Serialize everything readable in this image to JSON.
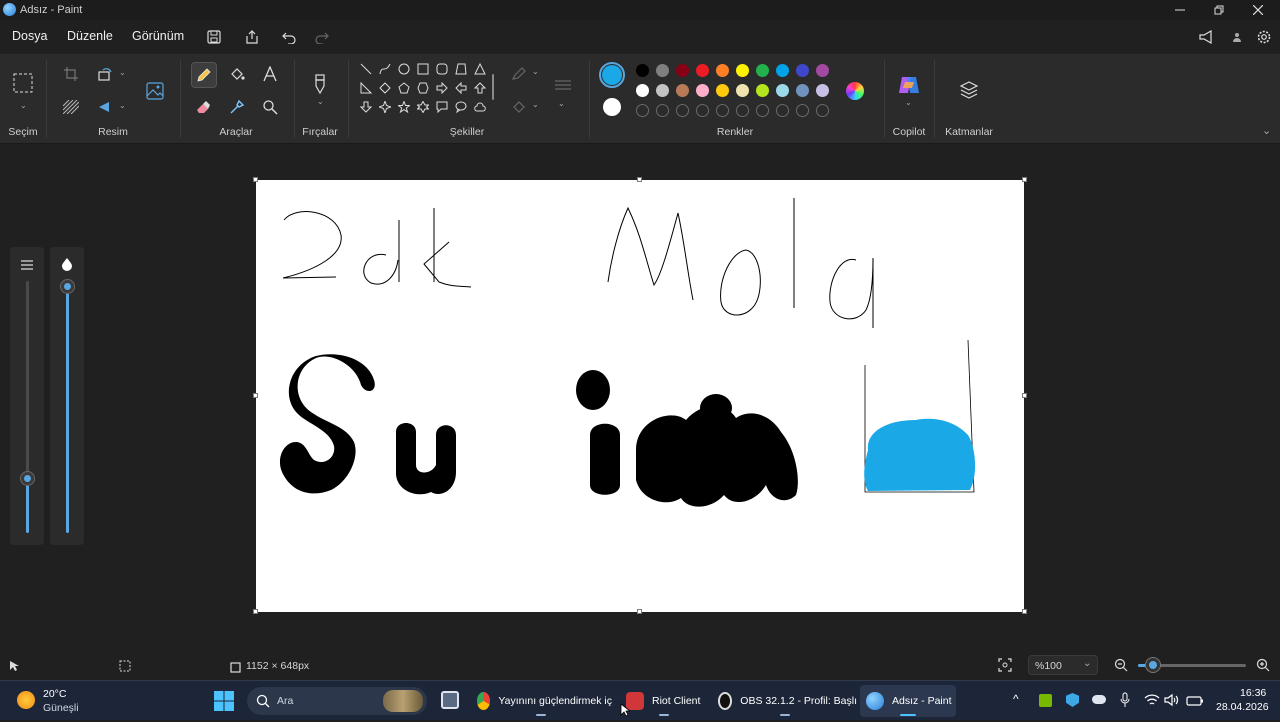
{
  "window": {
    "title": "Adsız - Paint"
  },
  "menu": {
    "file": "Dosya",
    "edit": "Düzenle",
    "view": "Görünüm"
  },
  "ribbon": {
    "groups": {
      "selection": "Seçim",
      "image": "Resim",
      "tools": "Araçlar",
      "brushes": "Fırçalar",
      "shapes": "Şekiller",
      "colors": "Renkler",
      "copilot": "Copilot",
      "layers": "Katmanlar"
    },
    "primary_color": "#1aa8e6",
    "secondary_color": "#ffffff",
    "palette_row1": [
      "#000000",
      "#7f7f7f",
      "#880015",
      "#ed1c24",
      "#ff7f27",
      "#fff200",
      "#22b14c",
      "#00a2e8",
      "#3f48cc",
      "#a349a4"
    ],
    "palette_row2": [
      "#ffffff",
      "#c3c3c3",
      "#b97a57",
      "#ffaec9",
      "#ffc90e",
      "#efe4b0",
      "#b5e61d",
      "#99d9ea",
      "#7092be",
      "#c8bfe7"
    ]
  },
  "status": {
    "canvas_size": "1152 × 648px",
    "zoom": "%100"
  },
  "taskbar": {
    "weather_temp": "20°C",
    "weather_desc": "Güneşli",
    "search_placeholder": "Ara",
    "apps": [
      {
        "label": "Yayınını güçlendirmek iç"
      },
      {
        "label": "Riot Client"
      },
      {
        "label": "OBS 32.1.2 - Profil: Başlı"
      },
      {
        "label": "Adsız - Paint"
      }
    ],
    "time": "16:36",
    "date": "28.04.2026"
  }
}
